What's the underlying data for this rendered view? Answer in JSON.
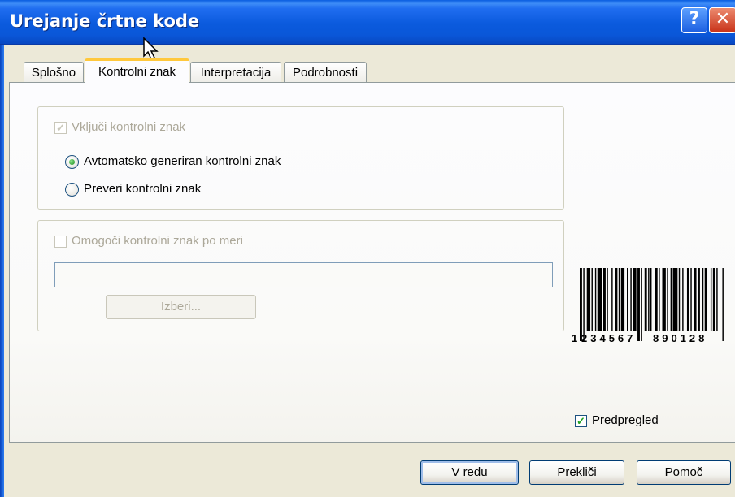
{
  "window": {
    "title": "Urejanje črtne kode",
    "help_label": "?",
    "close_label": "✕"
  },
  "tabs": [
    {
      "label": "Splošno",
      "active": false
    },
    {
      "label": "Kontrolni znak",
      "active": true
    },
    {
      "label": "Interpretacija",
      "active": false
    },
    {
      "label": "Podrobnosti",
      "active": false
    }
  ],
  "check_digit": {
    "include_label": "Vključi kontrolni znak",
    "include_checked": true,
    "include_enabled": false,
    "radio_auto_label": "Avtomatsko generiran kontrolni znak",
    "radio_auto_selected": true,
    "radio_verify_label": "Preveri kontrolni znak",
    "radio_verify_selected": false
  },
  "custom": {
    "enable_label": "Omogoči kontrolni znak po meri",
    "enable_checked": false,
    "enable_enabled": false,
    "value": "",
    "select_button": "Izberi..."
  },
  "preview": {
    "barcode_digits_first": "1",
    "barcode_digits_left": "234567",
    "barcode_digits_right": "890128",
    "preview_label": "Predpregled",
    "preview_checked": true
  },
  "footer": {
    "ok": "V redu",
    "cancel": "Prekliči",
    "help": "Pomoč"
  }
}
